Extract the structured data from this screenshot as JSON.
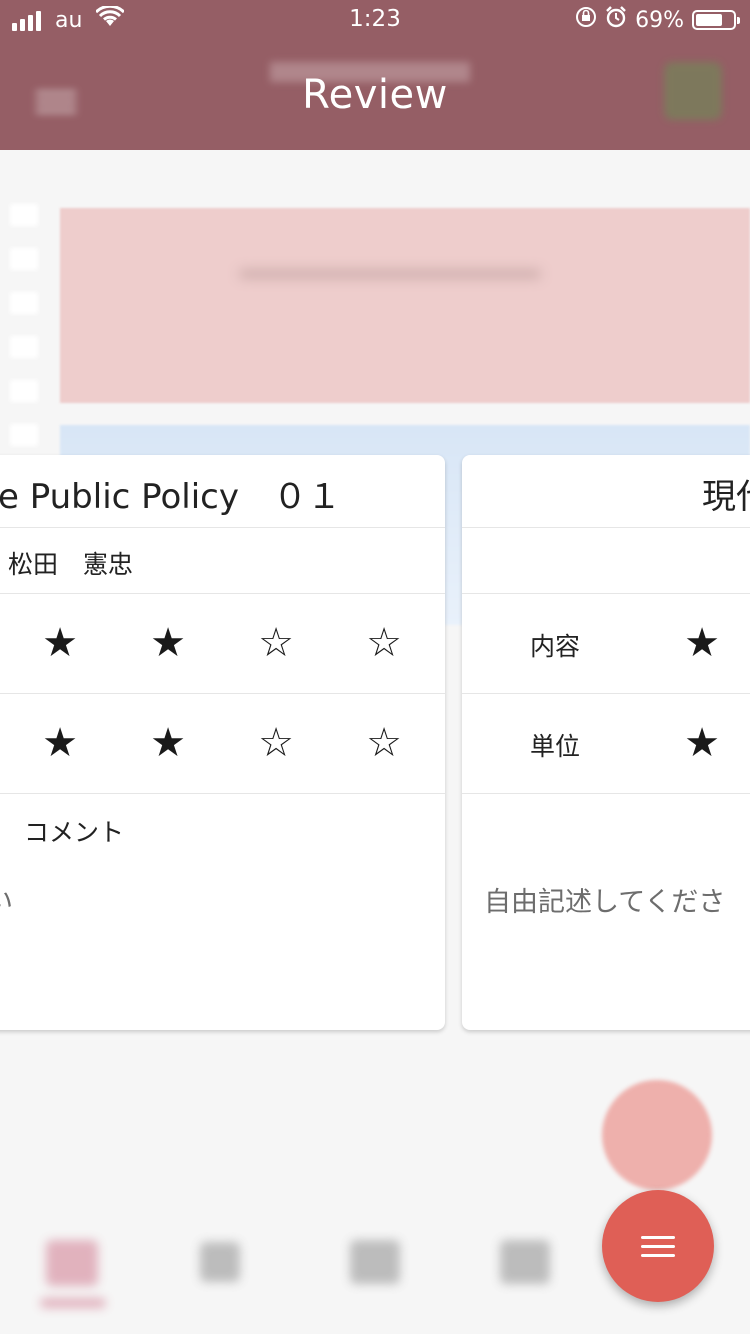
{
  "status_bar": {
    "carrier": "au",
    "time": "1:23",
    "battery": "69%"
  },
  "header": {
    "title": "Review"
  },
  "cards": [
    {
      "title": "e Public Policy　０１",
      "instructor": "松田　憲忠",
      "rating_rows": [
        {
          "label": "",
          "stars": [
            "★",
            "★",
            "☆",
            "☆"
          ]
        },
        {
          "label": "",
          "stars": [
            "★",
            "★",
            "☆",
            "☆"
          ]
        }
      ],
      "comment_label": "コメント",
      "comment_placeholder": "い"
    },
    {
      "title": "現代",
      "instructor": "",
      "rating_rows": [
        {
          "label": "内容",
          "stars": [
            "★"
          ]
        },
        {
          "label": "単位",
          "stars": [
            "★"
          ]
        }
      ],
      "comment_label": "",
      "comment_placeholder": "自由記述してくださ"
    }
  ],
  "icons": {
    "fab": "menu-icon"
  },
  "colors": {
    "header": "#955e65",
    "fab": "#df5f56"
  }
}
